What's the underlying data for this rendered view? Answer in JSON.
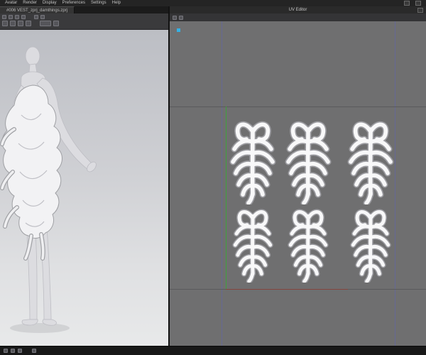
{
  "menu": {
    "items": [
      "Avatar",
      "Render",
      "Display",
      "Preferences",
      "Settings",
      "Help"
    ]
  },
  "tab": {
    "title": "#006 VEST_zprj_damthings.zprj"
  },
  "uv": {
    "title": "UV Editor"
  },
  "icons": {
    "toolbar3d": [
      "cursor",
      "translate",
      "rotate",
      "scale",
      "frame",
      "camera",
      "snap",
      "grid",
      "texture",
      "render-mode",
      "view-preset"
    ],
    "uv_toolbar": [
      "show-texture",
      "show-pattern"
    ],
    "bottombar": [
      "status-sync",
      "status-sim",
      "status-log",
      "status-mem"
    ],
    "window": [
      "layout",
      "minimize-panel"
    ]
  },
  "colors": {
    "canvas_gray": "#6f6f70",
    "axis_green": "#3da23d",
    "axis_red": "#84443e",
    "grid_blue": "#63679f",
    "marker_blue": "#35b1e5",
    "pattern_fill": "#f8f8f9",
    "pattern_outline": "#9b9ba0"
  }
}
